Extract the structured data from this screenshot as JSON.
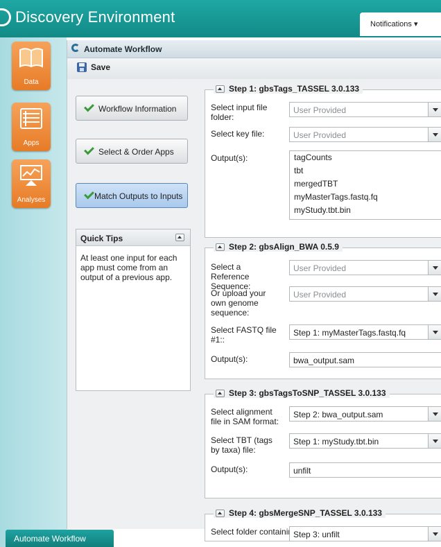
{
  "header": {
    "title": "Discovery Environment",
    "notifications_label": "Notifications ▾"
  },
  "sidebar": {
    "items": [
      {
        "label": "Data",
        "icon": "book-icon"
      },
      {
        "label": "Apps",
        "icon": "apps-list-icon"
      },
      {
        "label": "Analyses",
        "icon": "analyses-chart-icon"
      }
    ]
  },
  "taskbar": {
    "tab_label": "Automate Workflow"
  },
  "window": {
    "title": "Automate Workflow",
    "save_label": "Save"
  },
  "nav": {
    "workflow_info": "Workflow Information",
    "select_order": "Select & Order Apps",
    "match_outputs": "Match Outputs to Inputs"
  },
  "tips": {
    "title": "Quick Tips",
    "body": "At least one input for each app must come from an output of a previous app."
  },
  "steps": [
    {
      "title": "Step 1: gbsTags_TASSEL 3.0.133",
      "input_folder_label": "Select input file folder:",
      "input_folder_value": "User Provided",
      "key_file_label": "Select key file:",
      "key_file_value": "User Provided",
      "output_label": "Output(s):",
      "outputs": [
        "tagCounts",
        "tbt",
        "mergedTBT",
        "myMasterTags.fastq.fq",
        "myStudy.tbt.bin"
      ]
    },
    {
      "title": "Step 2: gbsAlign_BWA 0.5.9",
      "reference_label": "Select a Reference Sequence:",
      "reference_value": "User Provided",
      "upload_label": "Or upload your own genome sequence:",
      "upload_value": "User Provided",
      "fastq_label": "Select FASTQ file #1::",
      "fastq_value": "Step 1: myMasterTags.fastq.fq",
      "output_label": "Output(s):",
      "output_value": "bwa_output.sam"
    },
    {
      "title": "Step 3: gbsTagsToSNP_TASSEL 3.0.133",
      "alignment_label": "Select alignment file in SAM format:",
      "alignment_value": "Step 2: bwa_output.sam",
      "tbt_label": "Select TBT (tags by taxa) file:",
      "tbt_value": "Step 1: myStudy.tbt.bin",
      "output_label": "Output(s):",
      "output_value": "unfilt"
    },
    {
      "title": "Step 4: gbsMergeSNP_TASSEL 3.0.133",
      "folder_label": "Select folder containing",
      "folder_value": "Step 3: unfilt"
    }
  ]
}
